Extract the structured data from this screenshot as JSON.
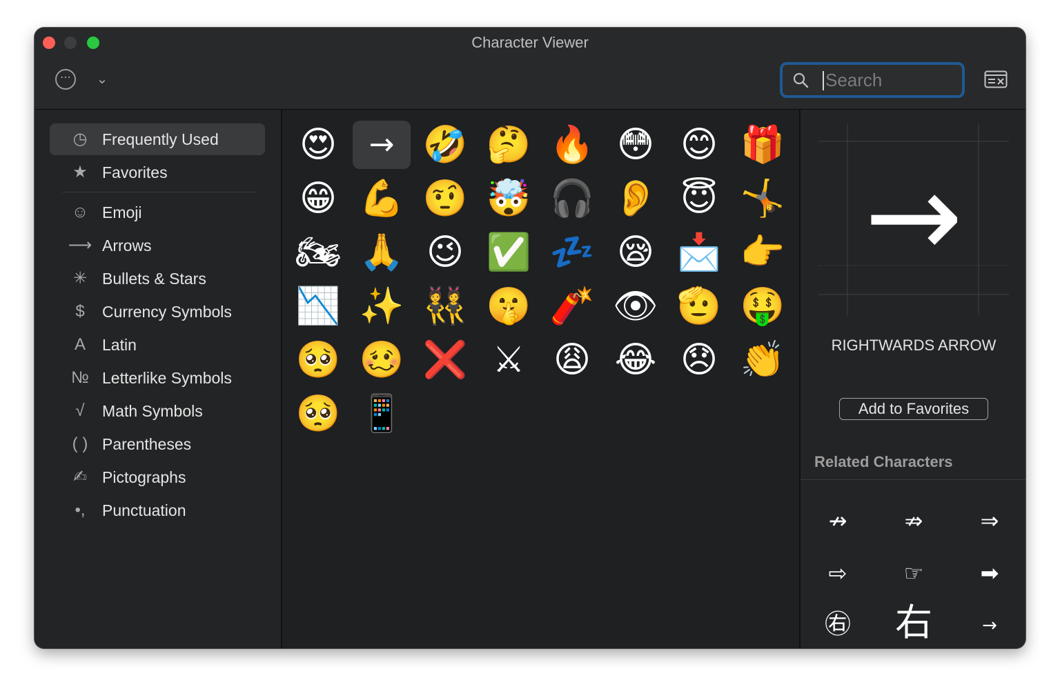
{
  "window": {
    "title": "Character Viewer"
  },
  "toolbar": {
    "action_icon": "ellipsis-circle-icon",
    "action_glyph": "⋯",
    "dropdown_glyph": "⌄",
    "search_placeholder": "Search",
    "search_value": ""
  },
  "sidebar": {
    "items": [
      {
        "label": "Frequently Used",
        "icon": "clock-icon",
        "glyph": "◷",
        "selected": true
      },
      {
        "label": "Favorites",
        "icon": "star-icon",
        "glyph": "★"
      },
      {
        "label": "Emoji",
        "icon": "smiley-icon",
        "glyph": "☺"
      },
      {
        "label": "Arrows",
        "icon": "arrow-icon",
        "glyph": "⟶"
      },
      {
        "label": "Bullets & Stars",
        "icon": "asterisk-icon",
        "glyph": "✳"
      },
      {
        "label": "Currency Symbols",
        "icon": "dollar-icon",
        "glyph": "$"
      },
      {
        "label": "Latin",
        "icon": "letter-a-icon",
        "glyph": "A"
      },
      {
        "label": "Letterlike Symbols",
        "icon": "numero-icon",
        "glyph": "№"
      },
      {
        "label": "Math Symbols",
        "icon": "square-root-icon",
        "glyph": "√"
      },
      {
        "label": "Parentheses",
        "icon": "parentheses-icon",
        "glyph": "( )"
      },
      {
        "label": "Pictographs",
        "icon": "pen-icon",
        "glyph": "✍"
      },
      {
        "label": "Punctuation",
        "icon": "comma-icon",
        "glyph": "•,"
      }
    ]
  },
  "grid": {
    "characters": [
      "😍",
      "→",
      "🤣",
      "🤔",
      "🔥",
      "😳",
      "😊",
      "🎁",
      "😁",
      "💪",
      "🤨",
      "🤯",
      "🎧",
      "👂",
      "😇",
      "🤸",
      "🏍",
      "🙏",
      "😉",
      "✅",
      "💤",
      "😪",
      "📩",
      "👉",
      "📉",
      "✨",
      "👯",
      "🤫",
      "🧨",
      "👁",
      "🫡",
      "🤑",
      "🥺",
      "🥴",
      "❌",
      "⚔",
      "😩",
      "😂",
      "😞",
      "👏",
      "🥺",
      "📱"
    ],
    "selected_index": 1
  },
  "detail": {
    "preview_glyph": "→",
    "name": "RIGHTWARDS ARROW",
    "add_to_favorites": "Add to Favorites",
    "related_title": "Related Characters",
    "related": [
      "↛",
      "⇏",
      "⇒",
      "⇨",
      "☞",
      "➡",
      "㊨",
      "右",
      "→"
    ]
  },
  "colors": {
    "window_bg": "#1e2022",
    "sidebar_bg": "#232426",
    "selection": "#3a3b3d",
    "search_focus": "#1e5a93",
    "close": "#fe5f57",
    "maximize": "#29c840"
  }
}
